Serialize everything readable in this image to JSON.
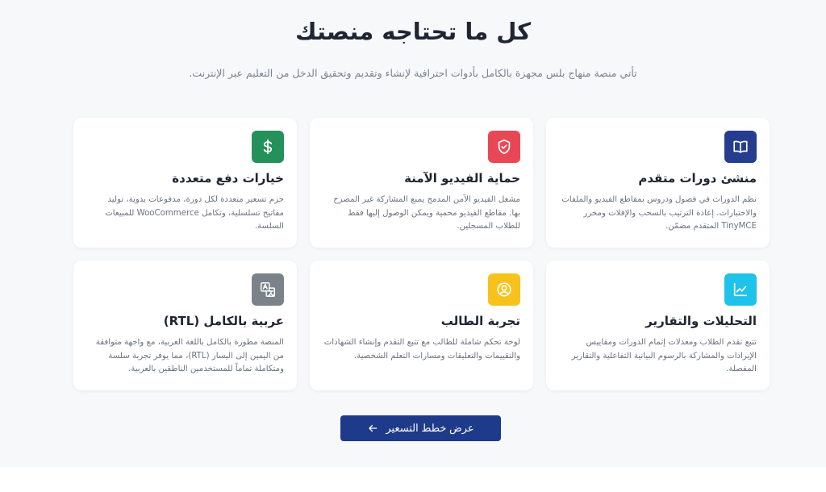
{
  "header": {
    "title": "كل ما تحتاجه منصتك",
    "subtitle": "تأتي منصة منهاج بلس مجهزة بالكامل بأدوات احترافية لإنشاء وتقديم وتحقيق الدخل من التعليم عبر الإنترنت."
  },
  "features": [
    {
      "title": "منشئ دورات متقدم",
      "description": "نظم الدورات في فصول ودروس بمقاطع الفيديو والملفات والاختبارات. إعادة الترتيب بالسحب والإفلات ومحرر TinyMCE المتقدم مضمّن.",
      "icon": "book-icon",
      "color": "#263d8f"
    },
    {
      "title": "حماية الفيديو الآمنة",
      "description": "مشغل الفيديو الآمن المدمج يمنع المشاركة غير المصرح بها. مقاطع الفيديو محمية ويمكن الوصول إليها فقط للطلاب المسجلين.",
      "icon": "shield-icon",
      "color": "#e84856"
    },
    {
      "title": "خيارات دفع متعددة",
      "description": "حزم تسعير متعددة لكل دورة، مدفوعات يدوية، توليد مفاتيح تسلسلية، وتكامل WooCommerce للمبيعات السلسة.",
      "icon": "dollar-icon",
      "color": "#25915a"
    },
    {
      "title": "التحليلات والتقارير",
      "description": "تتبع تقدم الطلاب ومعدلات إتمام الدورات ومقاييس الإيرادات والمشاركة بالرسوم البيانية التفاعلية والتقارير المفصلة.",
      "icon": "chart-icon",
      "color": "#1ec2ea"
    },
    {
      "title": "تجربة الطالب",
      "description": "لوحة تحكم شاملة للطالب مع تتبع التقدم وإنشاء الشهادات والتقييمات والتعليقات ومسارات التعلم الشخصية.",
      "icon": "user-circle-icon",
      "color": "#f7c21b"
    },
    {
      "title": "عربية بالكامل (RTL)",
      "description": "المنصة مطورة بالكامل باللغة العربية، مع واجهة متوافقة من اليمين إلى اليسار (RTL)، مما يوفر تجربة سلسة ومتكاملة تماماً للمستخدمين الناطقين بالعربية.",
      "icon": "translate-icon",
      "color": "#7b828a"
    }
  ],
  "cta": {
    "label": "عرض خطط التسعير",
    "icon": "arrow-left-icon"
  }
}
